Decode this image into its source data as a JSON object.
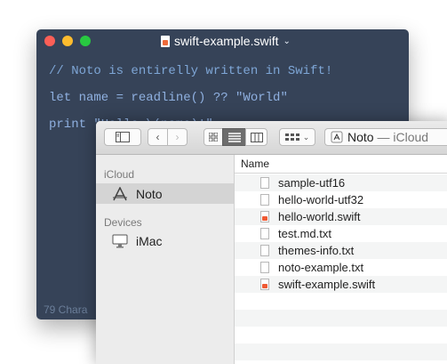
{
  "editor": {
    "title": "swift-example.swift",
    "code_lines": [
      "// Noto is entirelly written in Swift!",
      "let name = readline() ?? \"World\"",
      "print \"Hello \\(name)!\""
    ],
    "status": "79 Chara"
  },
  "finder": {
    "path_title": "Noto",
    "path_suffix": " — iCloud",
    "sidebar": {
      "sections": [
        {
          "heading": "iCloud",
          "items": [
            {
              "label": "Noto",
              "icon": "app-a-icon",
              "selected": true
            }
          ]
        },
        {
          "heading": "Devices",
          "items": [
            {
              "label": "iMac",
              "icon": "imac-icon",
              "selected": false
            }
          ]
        }
      ]
    },
    "column_header": "Name",
    "files": [
      {
        "name": "sample-utf16",
        "type": "text"
      },
      {
        "name": "hello-world-utf32",
        "type": "text"
      },
      {
        "name": "hello-world.swift",
        "type": "swift"
      },
      {
        "name": "test.md.txt",
        "type": "text"
      },
      {
        "name": "themes-info.txt",
        "type": "text"
      },
      {
        "name": "noto-example.txt",
        "type": "text"
      },
      {
        "name": "swift-example.swift",
        "type": "swift"
      },
      {
        "name": "",
        "type": "empty"
      },
      {
        "name": "",
        "type": "empty"
      },
      {
        "name": "",
        "type": "empty"
      },
      {
        "name": "",
        "type": "empty"
      },
      {
        "name": "",
        "type": "empty"
      }
    ]
  }
}
